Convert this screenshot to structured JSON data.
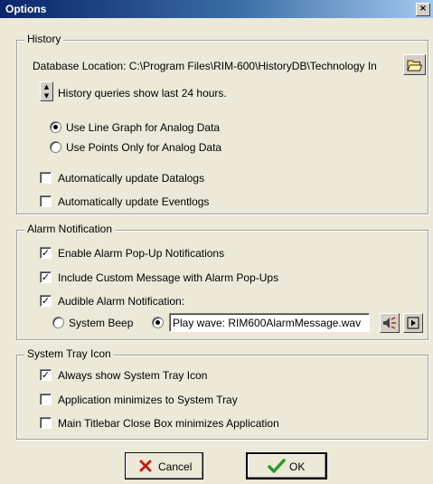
{
  "window": {
    "title": "Options",
    "close_glyph": "×"
  },
  "history": {
    "legend": "History",
    "db_label": "Database Location: C:\\Program Files\\RIM-600\\HistoryDB\\Technology In",
    "browse_icon": "open-folder-icon",
    "queries_text": "History queries show last 24 hours.",
    "radio_line": "Use Line Graph for Analog Data",
    "radio_points": "Use Points Only for Analog Data",
    "selected_graph_mode": "line",
    "auto_datalogs": "Automatically update Datalogs",
    "auto_datalogs_checked": false,
    "auto_eventlogs": "Automatically update Eventlogs",
    "auto_eventlogs_checked": false
  },
  "alarm": {
    "legend": "Alarm Notification",
    "enable_popups": "Enable Alarm Pop-Up Notifications",
    "enable_popups_checked": true,
    "custom_message": "Include Custom Message with Alarm Pop-Ups",
    "custom_message_checked": true,
    "audible": "Audible Alarm Notification:",
    "audible_checked": true,
    "system_beep": "System Beep",
    "play_wave": "Play wave:",
    "wave_file": "RIM600AlarmMessage.wav",
    "selected_sound": "play_wave",
    "speaker_icon": "speaker-icon",
    "play_icon": "play-icon"
  },
  "tray": {
    "legend": "System Tray Icon",
    "always_show": "Always show System Tray Icon",
    "always_show_checked": true,
    "minimizes_to_tray": "Application minimizes to System Tray",
    "minimizes_to_tray_checked": false,
    "close_box_minimizes": "Main Titlebar Close Box minimizes Application",
    "close_box_minimizes_checked": false
  },
  "buttons": {
    "cancel": "Cancel",
    "ok": "OK"
  },
  "colors": {
    "titlebar": "#0a246a",
    "dialog_bg": "#ece9d8",
    "cancel_x": "#c0201a",
    "ok_check": "#2e9a2e"
  }
}
